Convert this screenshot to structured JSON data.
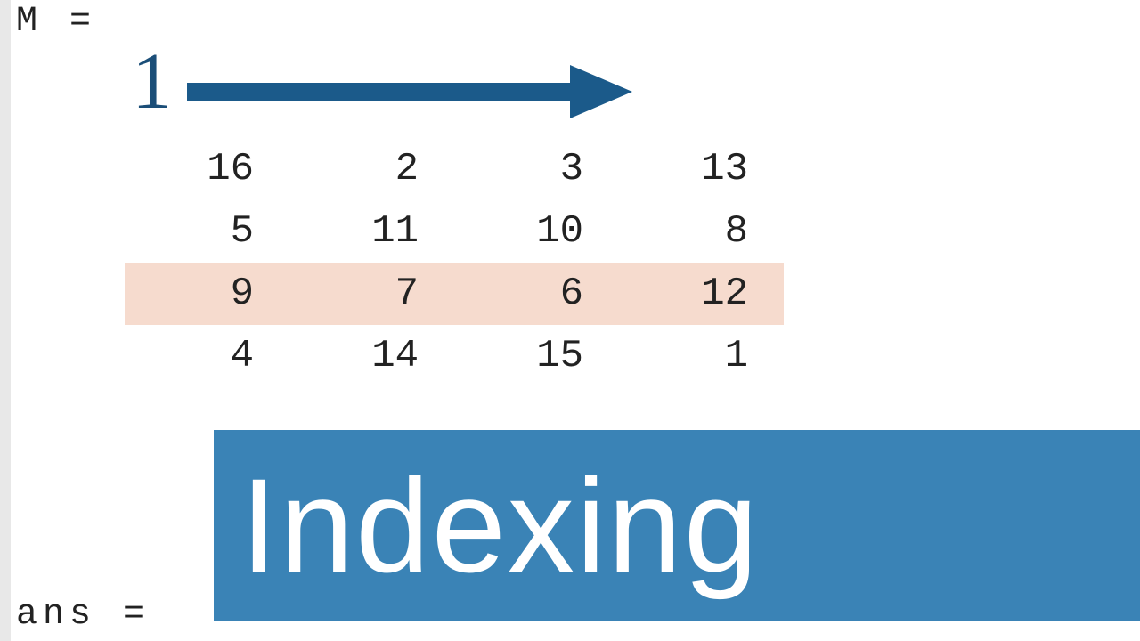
{
  "variables": {
    "m_label": "M =",
    "ans_label": "ans ="
  },
  "annotation": {
    "index_one": "1"
  },
  "matrix": {
    "highlighted_row_index": 2,
    "rows": [
      [
        "16",
        "2",
        "3",
        "13"
      ],
      [
        "5",
        "11",
        "10",
        "8"
      ],
      [
        "9",
        "7",
        "6",
        "12"
      ],
      [
        "4",
        "14",
        "15",
        "1"
      ]
    ]
  },
  "banner": {
    "title": "Indexing",
    "bg_color": "#3a83b6"
  },
  "colors": {
    "arrow": "#1b5a8a",
    "index_one": "#1b4e78",
    "highlight_row": "#f6dbce"
  }
}
